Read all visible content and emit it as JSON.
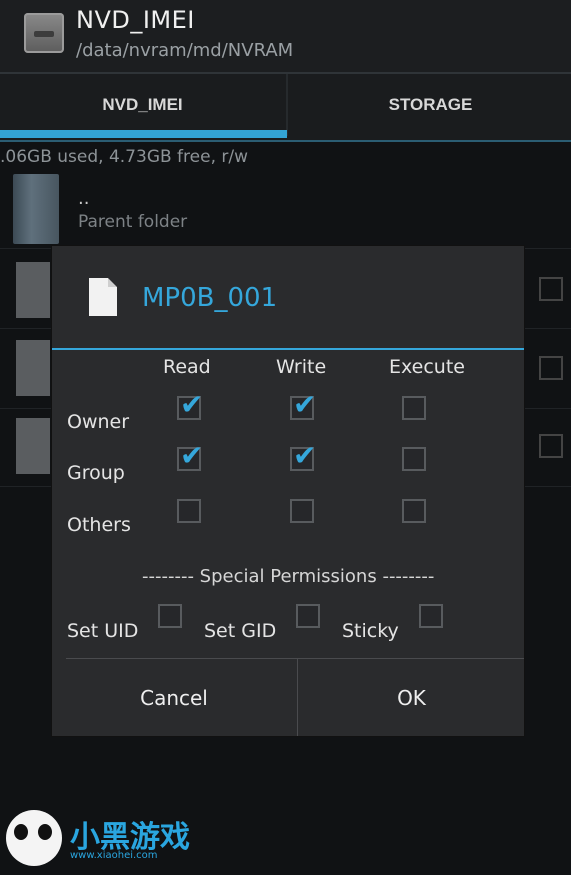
{
  "header": {
    "title": "NVD_IMEI",
    "path": "/data/nvram/md/NVRAM",
    "icon": "drive-icon"
  },
  "tabs": [
    {
      "label": "NVD_IMEI",
      "active": true
    },
    {
      "label": "STORAGE",
      "active": false
    }
  ],
  "storage_info": ".06GB used, 4.73GB free, r/w",
  "file_list": {
    "parent": {
      "name": "..",
      "description": "Parent folder"
    }
  },
  "dialog": {
    "file_name": "MP0B_001",
    "columns": [
      "Read",
      "Write",
      "Execute"
    ],
    "rows": [
      {
        "label": "Owner",
        "checks": [
          true,
          true,
          false
        ]
      },
      {
        "label": "Group",
        "checks": [
          true,
          true,
          false
        ]
      },
      {
        "label": "Others",
        "checks": [
          false,
          false,
          false
        ]
      }
    ],
    "special_heading": "-------- Special Permissions --------",
    "special": [
      {
        "label": "Set UID",
        "checked": false
      },
      {
        "label": "Set GID",
        "checked": false
      },
      {
        "label": "Sticky",
        "checked": false
      }
    ],
    "buttons": {
      "cancel": "Cancel",
      "ok": "OK"
    }
  },
  "colors": {
    "accent": "#35a7db",
    "background": "#101214",
    "dialog": "#2a2b2d"
  },
  "watermark": {
    "text": "小黑游戏",
    "url": "www.xiaohei.com"
  }
}
